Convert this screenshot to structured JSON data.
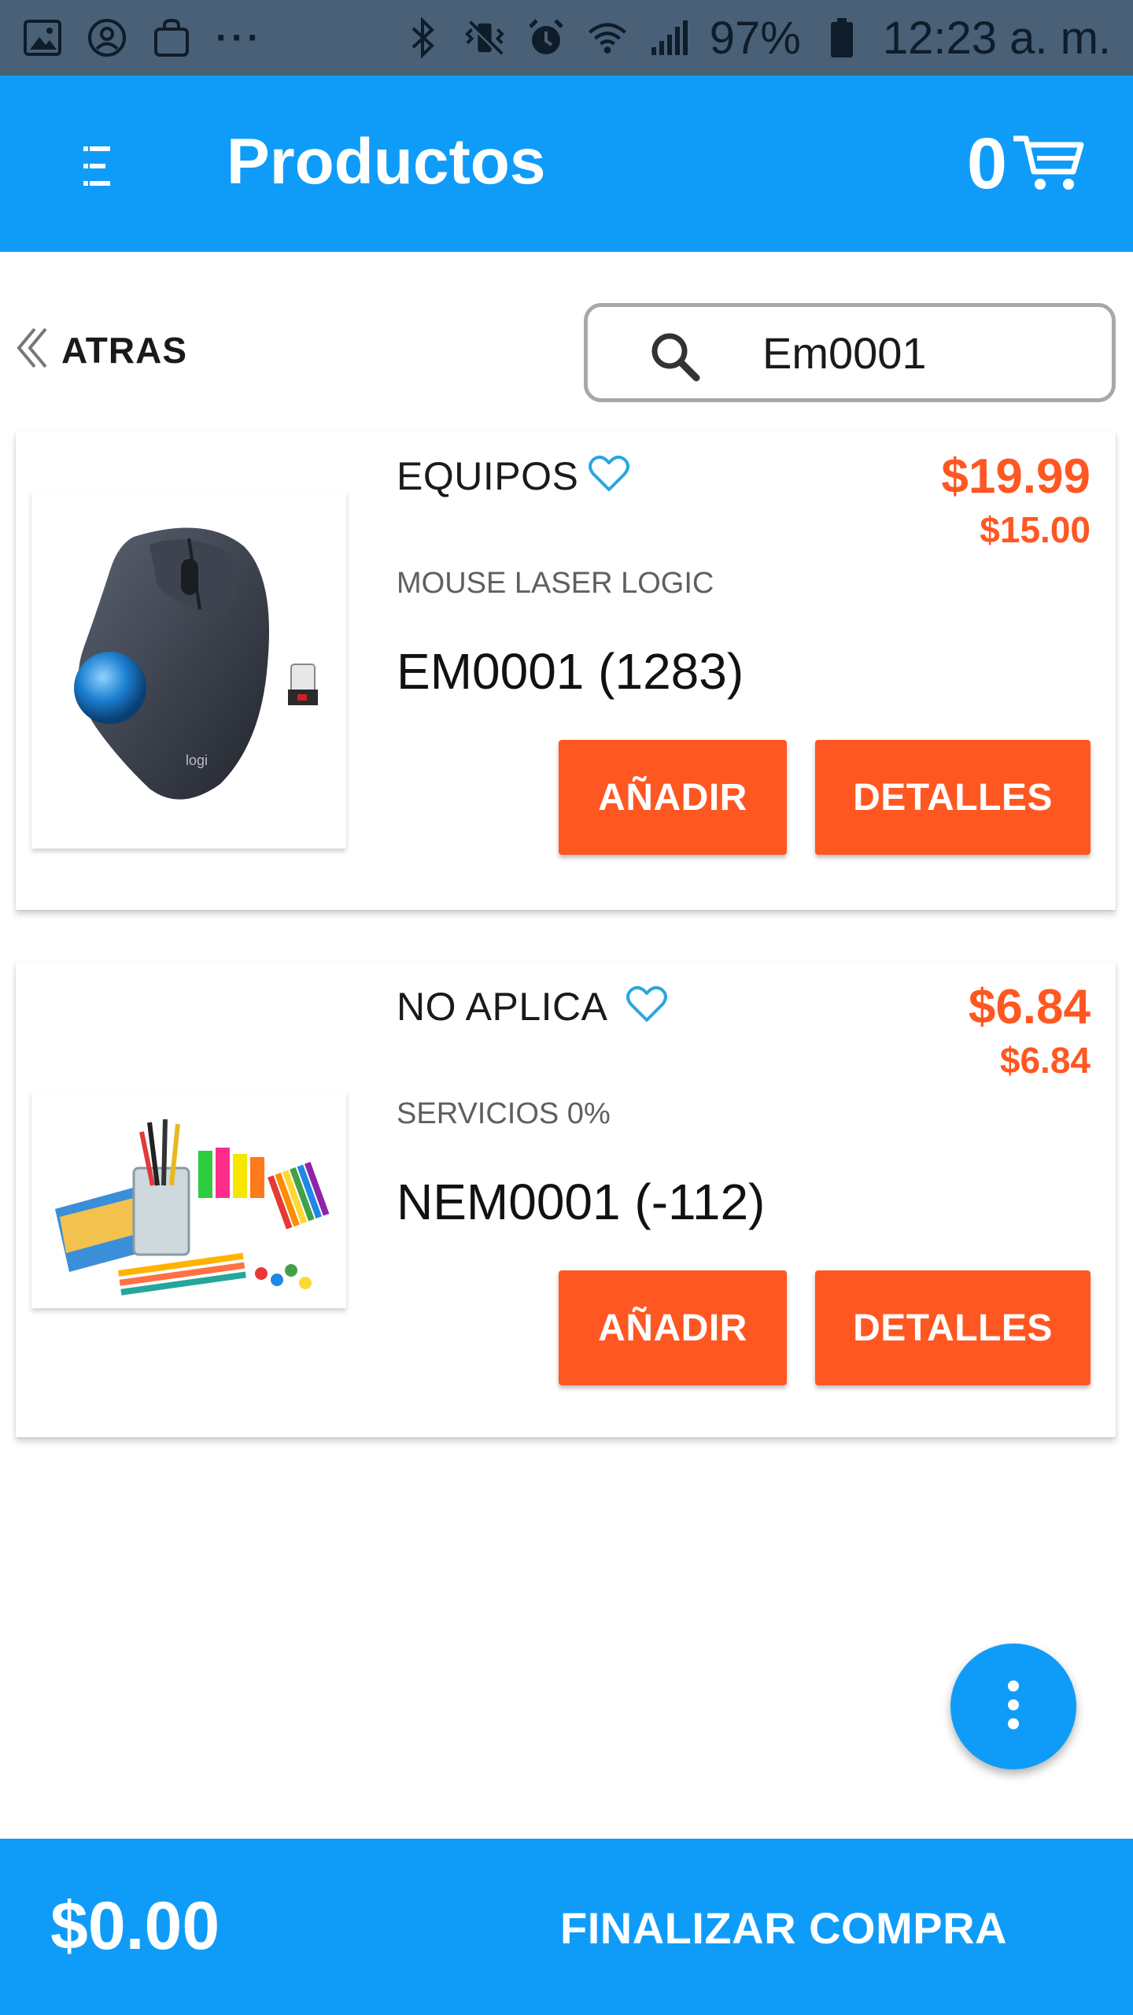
{
  "status_bar": {
    "battery": "97%",
    "time": "12:23 a. m.",
    "left_icons": [
      "gallery-icon",
      "account-icon",
      "shopping-bag-icon",
      "more-dots-icon"
    ],
    "right_icons": [
      "bluetooth-icon",
      "vibrate-icon",
      "alarm-icon",
      "wifi-icon",
      "signal-icon",
      "battery-icon"
    ]
  },
  "app_bar": {
    "title": "Productos",
    "cart_count": "0",
    "menu_icon": "menu-icon",
    "cart_icon": "cart-icon"
  },
  "toolbar": {
    "back_label": "ATRAS",
    "search_value": "Em0001"
  },
  "products": [
    {
      "category": "EQUIPOS",
      "price": "$19.99",
      "price_sub": "$15.00",
      "name": "MOUSE LASER LOGIC",
      "code": "EM0001 (1283)",
      "add_label": "AÑADIR",
      "details_label": "DETALLES",
      "image_icon": "trackball-mouse-image",
      "logo_text": "logi"
    },
    {
      "category": "NO APLICA",
      "price": "$6.84",
      "price_sub": "$6.84",
      "name": "SERVICIOS 0%",
      "code": "NEM0001 (-112)",
      "add_label": "AÑADIR",
      "details_label": "DETALLES",
      "image_icon": "office-supplies-image"
    }
  ],
  "fab": {
    "icon": "more-vertical-icon"
  },
  "bottom_bar": {
    "total": "$0.00",
    "checkout_label": "FINALIZAR COMPRA"
  },
  "colors": {
    "primary": "#0f9cf9",
    "accent": "#ff5722",
    "status_bar": "#4a6076",
    "heart": "#2aa7e0"
  }
}
